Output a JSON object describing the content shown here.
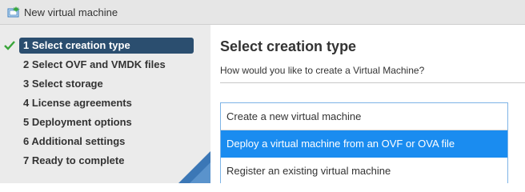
{
  "window": {
    "title": "New virtual machine",
    "icon": "new-vm-icon"
  },
  "sidebar": {
    "steps": [
      {
        "label": "1 Select creation type",
        "active": true,
        "completed": true
      },
      {
        "label": "2 Select OVF and VMDK files"
      },
      {
        "label": "3 Select storage"
      },
      {
        "label": "4 License agreements"
      },
      {
        "label": "5 Deployment options"
      },
      {
        "label": "6 Additional settings"
      },
      {
        "label": "7 Ready to complete"
      }
    ]
  },
  "main": {
    "heading": "Select creation type",
    "subtitle": "How would you like to create a Virtual Machine?",
    "options": [
      {
        "label": "Create a new virtual machine",
        "selected": false
      },
      {
        "label": "Deploy a virtual machine from an OVF or OVA file",
        "selected": true
      },
      {
        "label": "Register an existing virtual machine",
        "selected": false
      }
    ]
  },
  "colors": {
    "active_step_bg": "#2b4e6f",
    "selection_bg": "#1a8cf0",
    "check_green": "#3aa53a"
  }
}
